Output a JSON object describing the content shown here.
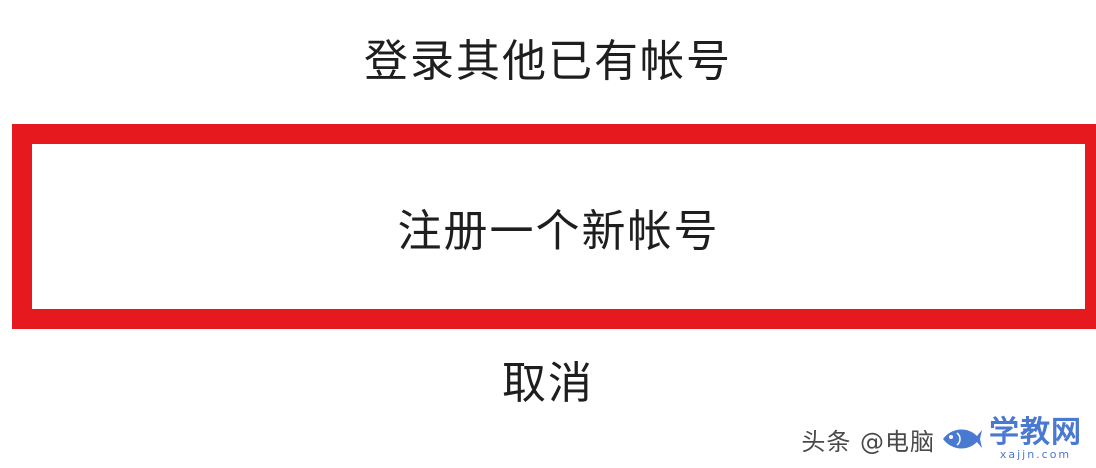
{
  "action_sheet": {
    "options": [
      {
        "label": "登录其他已有帐号"
      },
      {
        "label": "注册一个新帐号"
      },
      {
        "label": "取消"
      }
    ]
  },
  "highlight": {
    "color": "#e5191e"
  },
  "watermark": {
    "source_text": "头条 @电脑",
    "logo_text": "学教网",
    "logo_domain": "xajjn.com"
  }
}
